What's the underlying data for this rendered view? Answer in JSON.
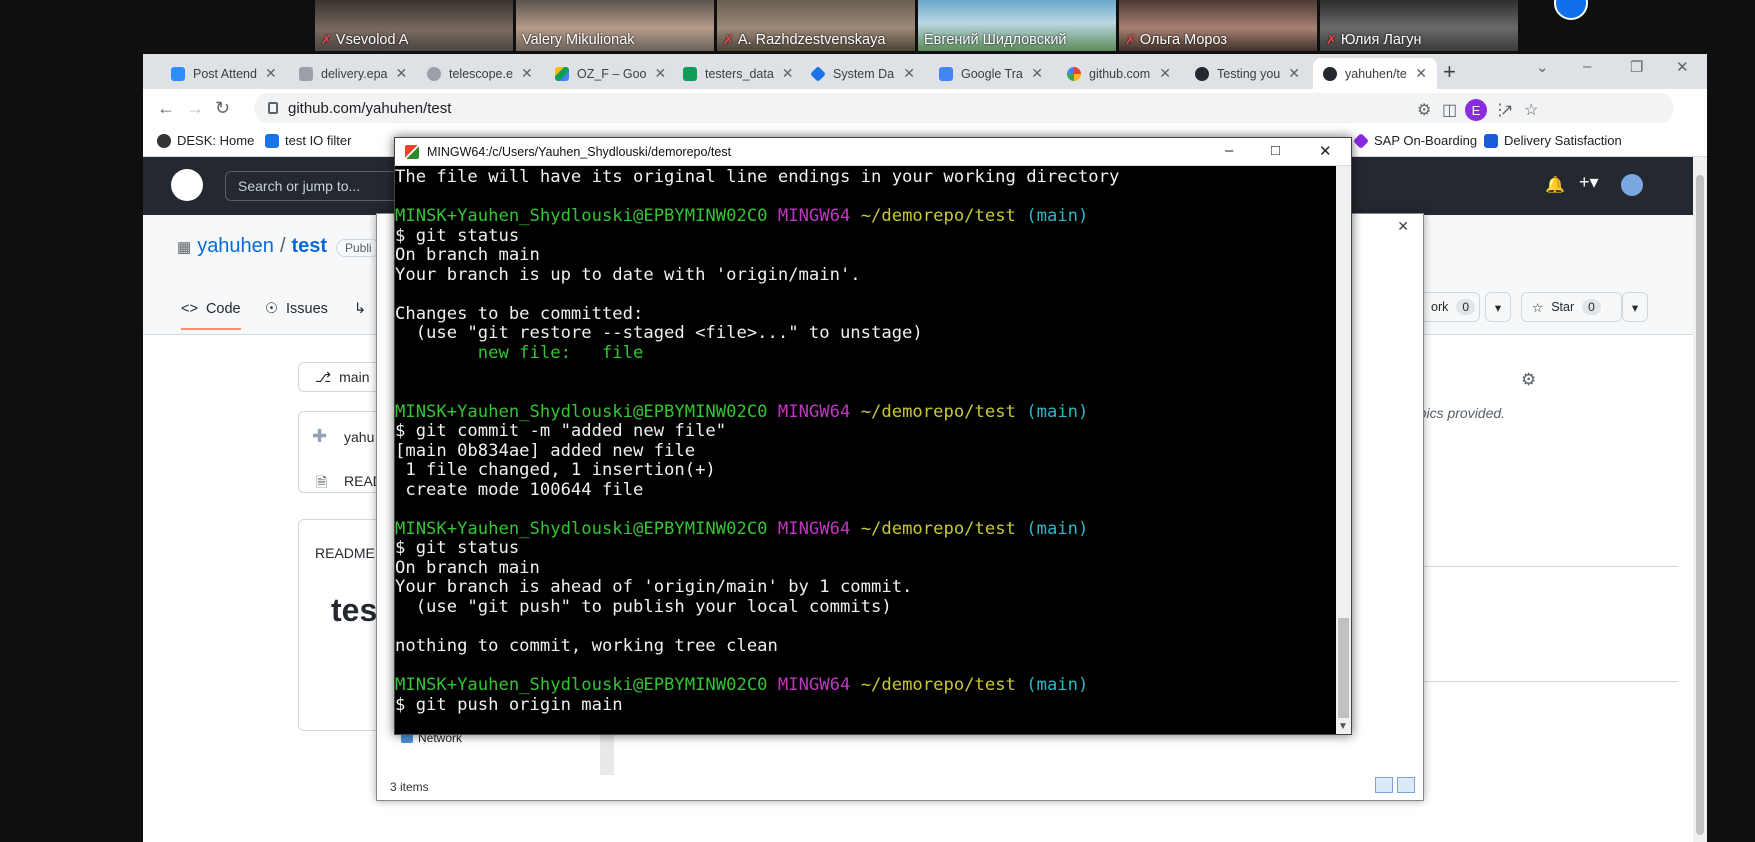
{
  "participants": [
    {
      "name": "Vsevolod A",
      "muted": true
    },
    {
      "name": "Valery Mikulionak",
      "muted": false
    },
    {
      "name": "A. Razhdzestvenskaya",
      "muted": true
    },
    {
      "name": "Евгений Шидловский",
      "muted": false
    },
    {
      "name": "Ольга Мороз",
      "muted": true
    },
    {
      "name": "Юлия Лагун",
      "muted": true
    }
  ],
  "browser": {
    "tabs": [
      {
        "title": "Post Attend",
        "icon_color": "#2d8cff"
      },
      {
        "title": "delivery.epa",
        "icon_color": "#5f6368"
      },
      {
        "title": "telescope.e",
        "icon_color": "#5f6368"
      },
      {
        "title": "OZ_F – Goo",
        "icon_color": "#0f9d58"
      },
      {
        "title": "testers_data",
        "icon_color": "#0f9d58"
      },
      {
        "title": "System Da",
        "icon_color": "#1a73e8"
      },
      {
        "title": "Google Tra",
        "icon_color": "#4285f4"
      },
      {
        "title": "github.com",
        "icon_color": "#ea4335"
      },
      {
        "title": "Testing you",
        "icon_color": "#24292f"
      },
      {
        "title": "yahuhen/te",
        "icon_color": "#24292f"
      }
    ],
    "url": "github.com/yahuhen/test",
    "profile_initial": "E",
    "bookmarks": [
      {
        "label": "DESK: Home"
      },
      {
        "label": "test IO filter"
      },
      {
        "label": "SAP On-Boarding"
      },
      {
        "label": "Delivery Satisfaction"
      }
    ]
  },
  "github": {
    "search_placeholder": "Search or jump to...",
    "owner": "yahuhen",
    "slash": "/",
    "repo": "test",
    "visibility": "Publi",
    "tabs": {
      "code": "Code",
      "issues": "Issues"
    },
    "fork_label": "ork",
    "fork_count": "0",
    "star_label": "Star",
    "star_count": "0",
    "branch": "main",
    "topics_text": "topics provided.",
    "owner_frag": "yahu",
    "readme_frag": "READ",
    "readme_header": "README.",
    "readme_title": "test"
  },
  "explorer": {
    "network_label": "Network",
    "item_count": "3 items"
  },
  "terminal": {
    "title": "MINGW64:/c/Users/Yauhen_Shydlouski/demorepo/test",
    "prompt": {
      "user": "MINSK+Yauhen_Shydlouski@EPBYMINW02C0",
      "shell": "MINGW64",
      "path": "~/demorepo/test",
      "branch": "(main)"
    },
    "lines": [
      {
        "kind": "text",
        "text": "The file will have its original line endings in your working directory"
      },
      {
        "kind": "blank",
        "text": ""
      },
      {
        "kind": "prompt",
        "text": ""
      },
      {
        "kind": "text",
        "text": "$ git status"
      },
      {
        "kind": "text",
        "text": "On branch main"
      },
      {
        "kind": "text",
        "text": "Your branch is up to date with 'origin/main'."
      },
      {
        "kind": "blank",
        "text": ""
      },
      {
        "kind": "text",
        "text": "Changes to be committed:"
      },
      {
        "kind": "text",
        "text": "  (use \"git restore --staged <file>...\" to unstage)"
      },
      {
        "kind": "staged",
        "text": "        new file:   file"
      },
      {
        "kind": "blank",
        "text": ""
      },
      {
        "kind": "blank",
        "text": ""
      },
      {
        "kind": "prompt",
        "text": ""
      },
      {
        "kind": "text",
        "text": "$ git commit -m \"added new file\""
      },
      {
        "kind": "text",
        "text": "[main 0b834ae] added new file"
      },
      {
        "kind": "text",
        "text": " 1 file changed, 1 insertion(+)"
      },
      {
        "kind": "text",
        "text": " create mode 100644 file"
      },
      {
        "kind": "blank",
        "text": ""
      },
      {
        "kind": "prompt",
        "text": ""
      },
      {
        "kind": "text",
        "text": "$ git status"
      },
      {
        "kind": "text",
        "text": "On branch main"
      },
      {
        "kind": "text",
        "text": "Your branch is ahead of 'origin/main' by 1 commit."
      },
      {
        "kind": "text",
        "text": "  (use \"git push\" to publish your local commits)"
      },
      {
        "kind": "blank",
        "text": ""
      },
      {
        "kind": "text",
        "text": "nothing to commit, working tree clean"
      },
      {
        "kind": "blank",
        "text": ""
      },
      {
        "kind": "prompt",
        "text": ""
      },
      {
        "kind": "text",
        "text": "$ git push origin main"
      }
    ],
    "colors": {
      "user": "#34c434",
      "shell": "#c434c4",
      "path": "#c8c834",
      "branch": "#2cb8c8"
    }
  }
}
